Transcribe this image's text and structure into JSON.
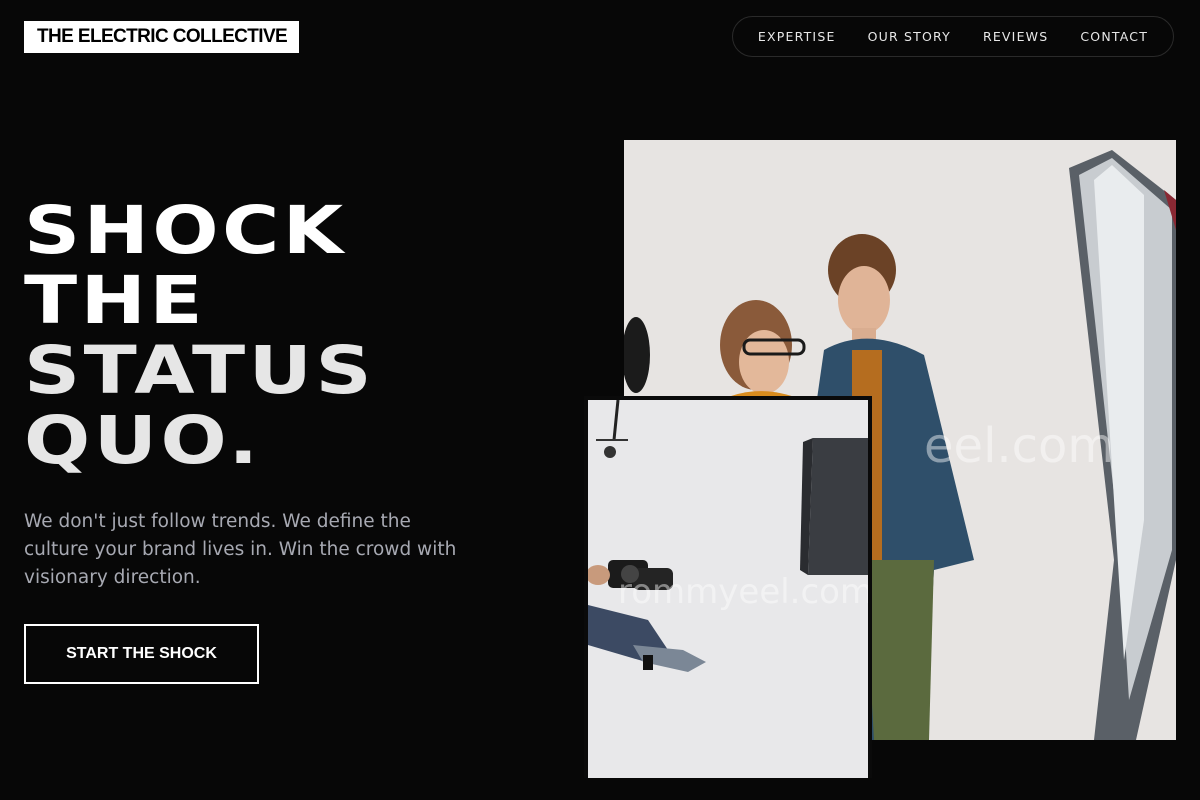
{
  "brand": {
    "logo_text": "THE ELECTRIC COLLECTIVE"
  },
  "nav": {
    "items": [
      {
        "label": "EXPERTISE"
      },
      {
        "label": "OUR STORY"
      },
      {
        "label": "REVIEWS"
      },
      {
        "label": "CONTACT"
      }
    ]
  },
  "hero": {
    "headline_lines": [
      "SHOCK",
      "THE",
      "STATUS",
      "QUO."
    ],
    "subtitle": "We don't just follow trends. We define the culture your brand lives in. Win the crowd with visionary direction.",
    "cta_label": "START THE SHOCK"
  },
  "images": {
    "main_watermark": "eel.com",
    "small_watermark": "rommyeel.com"
  },
  "colors": {
    "background": "#070707",
    "text": "#ffffff",
    "subtitle": "#a7a9b2",
    "logo_bg": "#ffffff"
  }
}
